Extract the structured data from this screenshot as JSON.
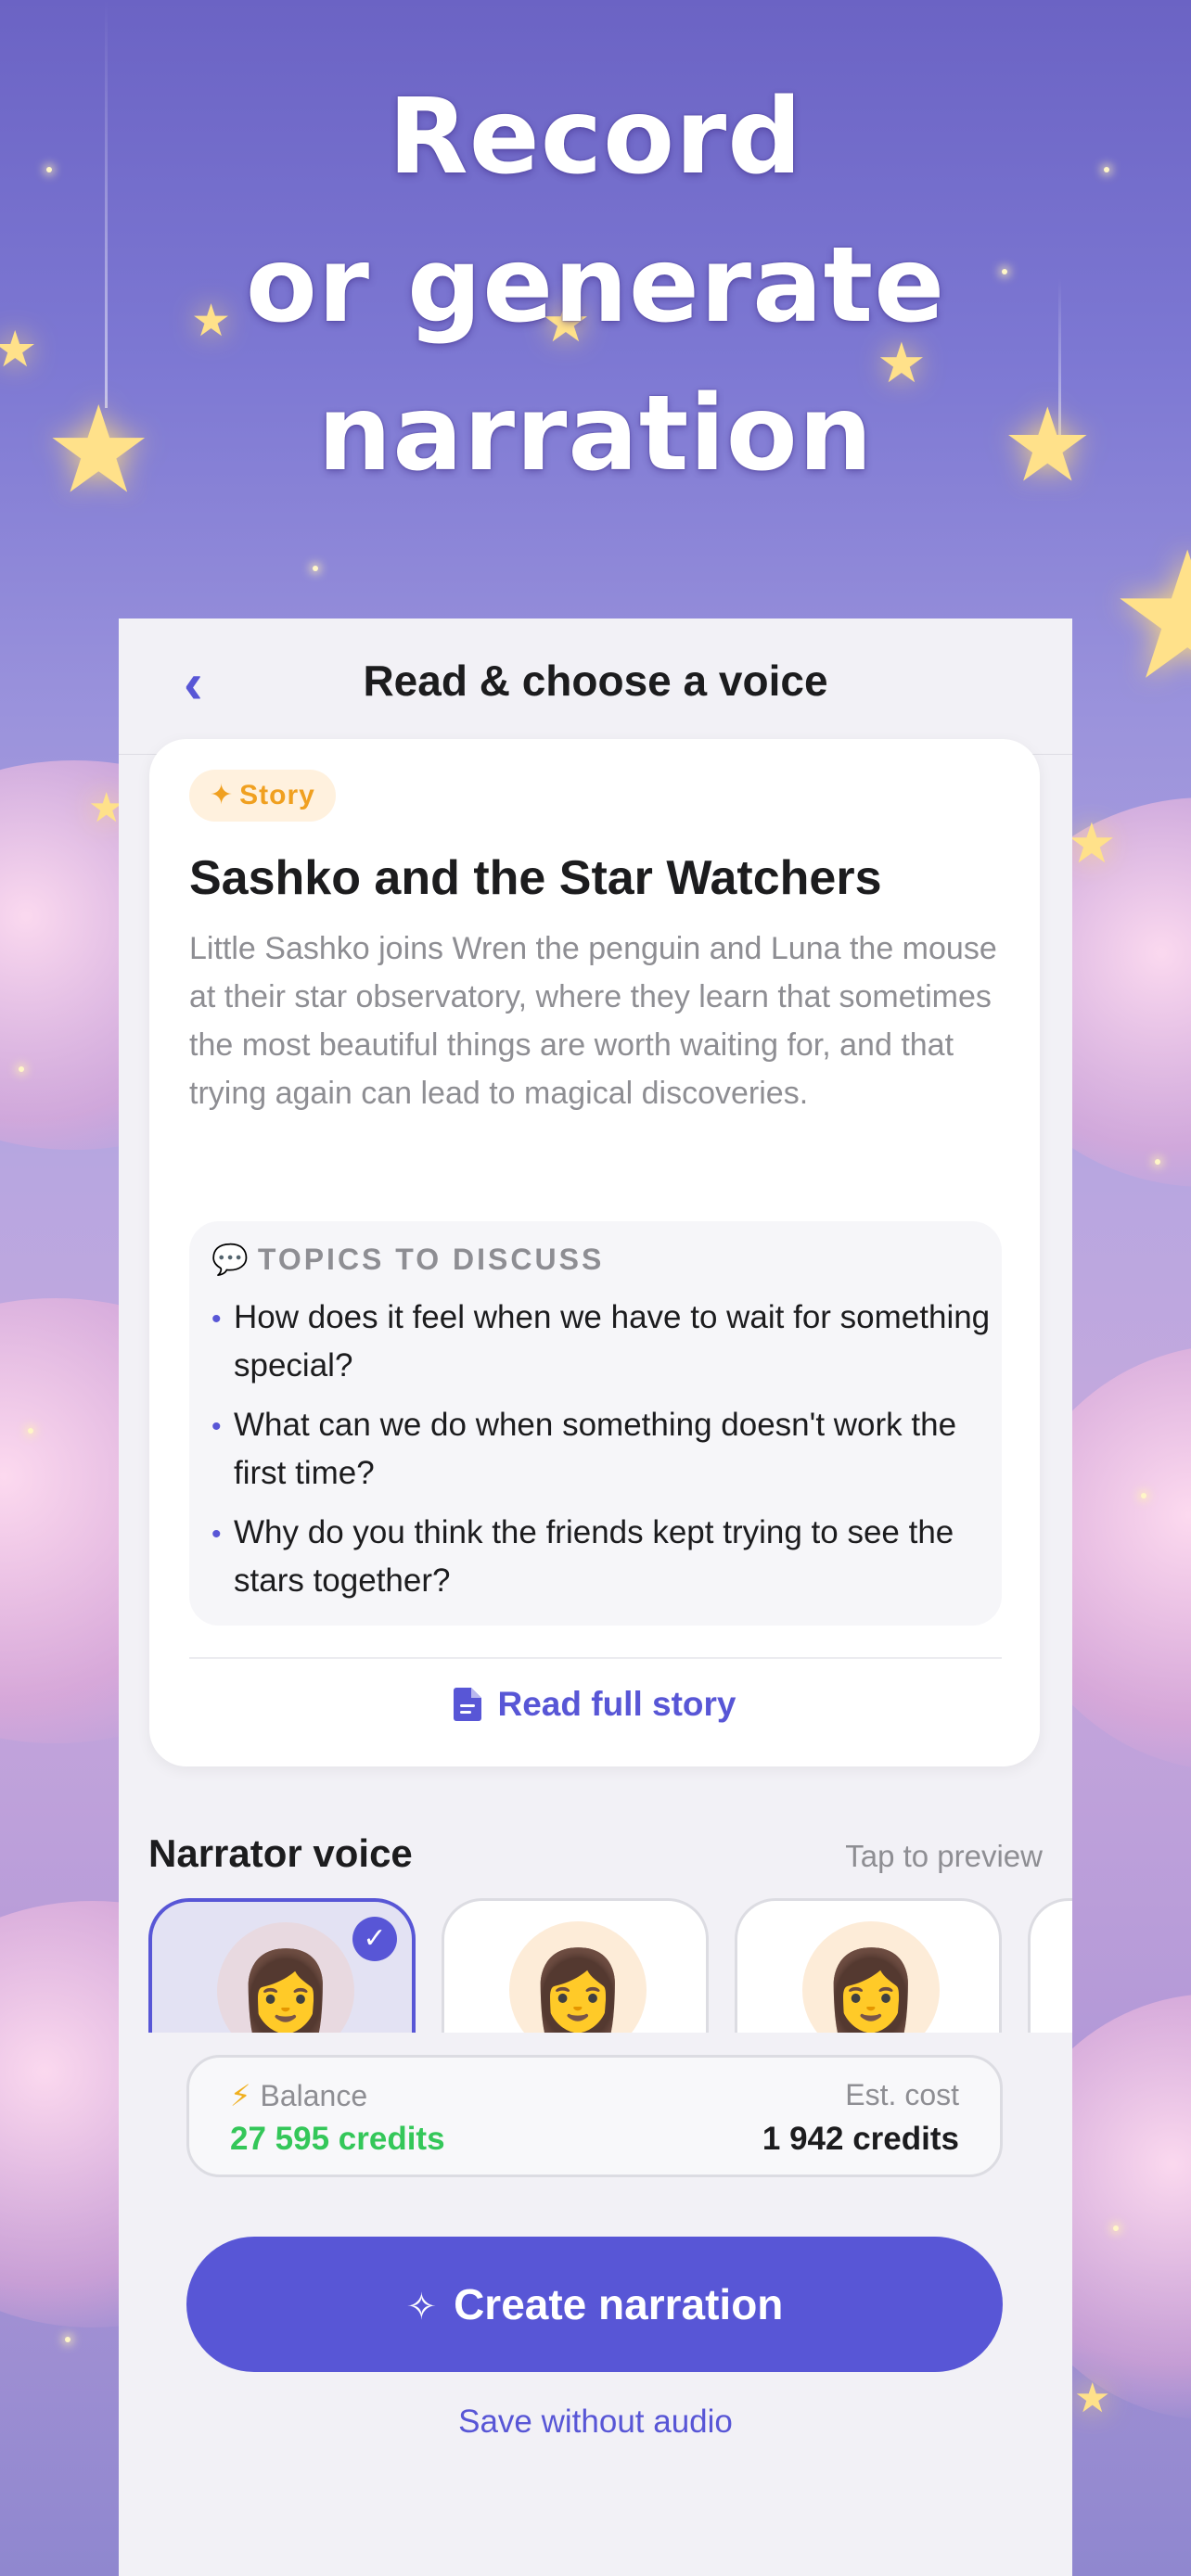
{
  "headline": {
    "line1": "Record",
    "line2": "or generate",
    "line3": "narration"
  },
  "nav": {
    "back_icon": "chevron-left-icon",
    "back_glyph": "‹",
    "title": "Read & choose a voice"
  },
  "story": {
    "badge": "Story",
    "badge_icon": "✦",
    "title": "Sashko and the Star Watchers",
    "description": "Little Sashko joins Wren the penguin and Luna the mouse at their star observatory, where they learn that sometimes the most beautiful things are worth waiting for, and that trying again can lead to magical discoveries.",
    "topics_heading": "TOPICS TO DISCUSS",
    "topics_icon": "💬",
    "topics": [
      "How does it feel when we have to wait for something special?",
      "What can we do when something doesn't work the first time?",
      "Why do you think the friends kept trying to see the stars together?"
    ],
    "read_full": "Read full story"
  },
  "voices": {
    "title": "Narrator voice",
    "hint": "Tap to preview",
    "items": [
      {
        "avatar": "👩",
        "selected": true
      },
      {
        "avatar": "👩",
        "selected": false
      },
      {
        "avatar": "👩",
        "selected": false
      }
    ],
    "check_glyph": "✓"
  },
  "balance": {
    "icon": "⚡",
    "label": "Balance",
    "value": "27 595 credits",
    "cost_label": "Est. cost",
    "cost_value": "1 942 credits"
  },
  "actions": {
    "create_icon": "✧",
    "create_label": "Create narration",
    "save_label": "Save without audio"
  },
  "colors": {
    "accent": "#5856d6",
    "balance_green": "#34c759",
    "badge_orange": "#f0a020"
  }
}
